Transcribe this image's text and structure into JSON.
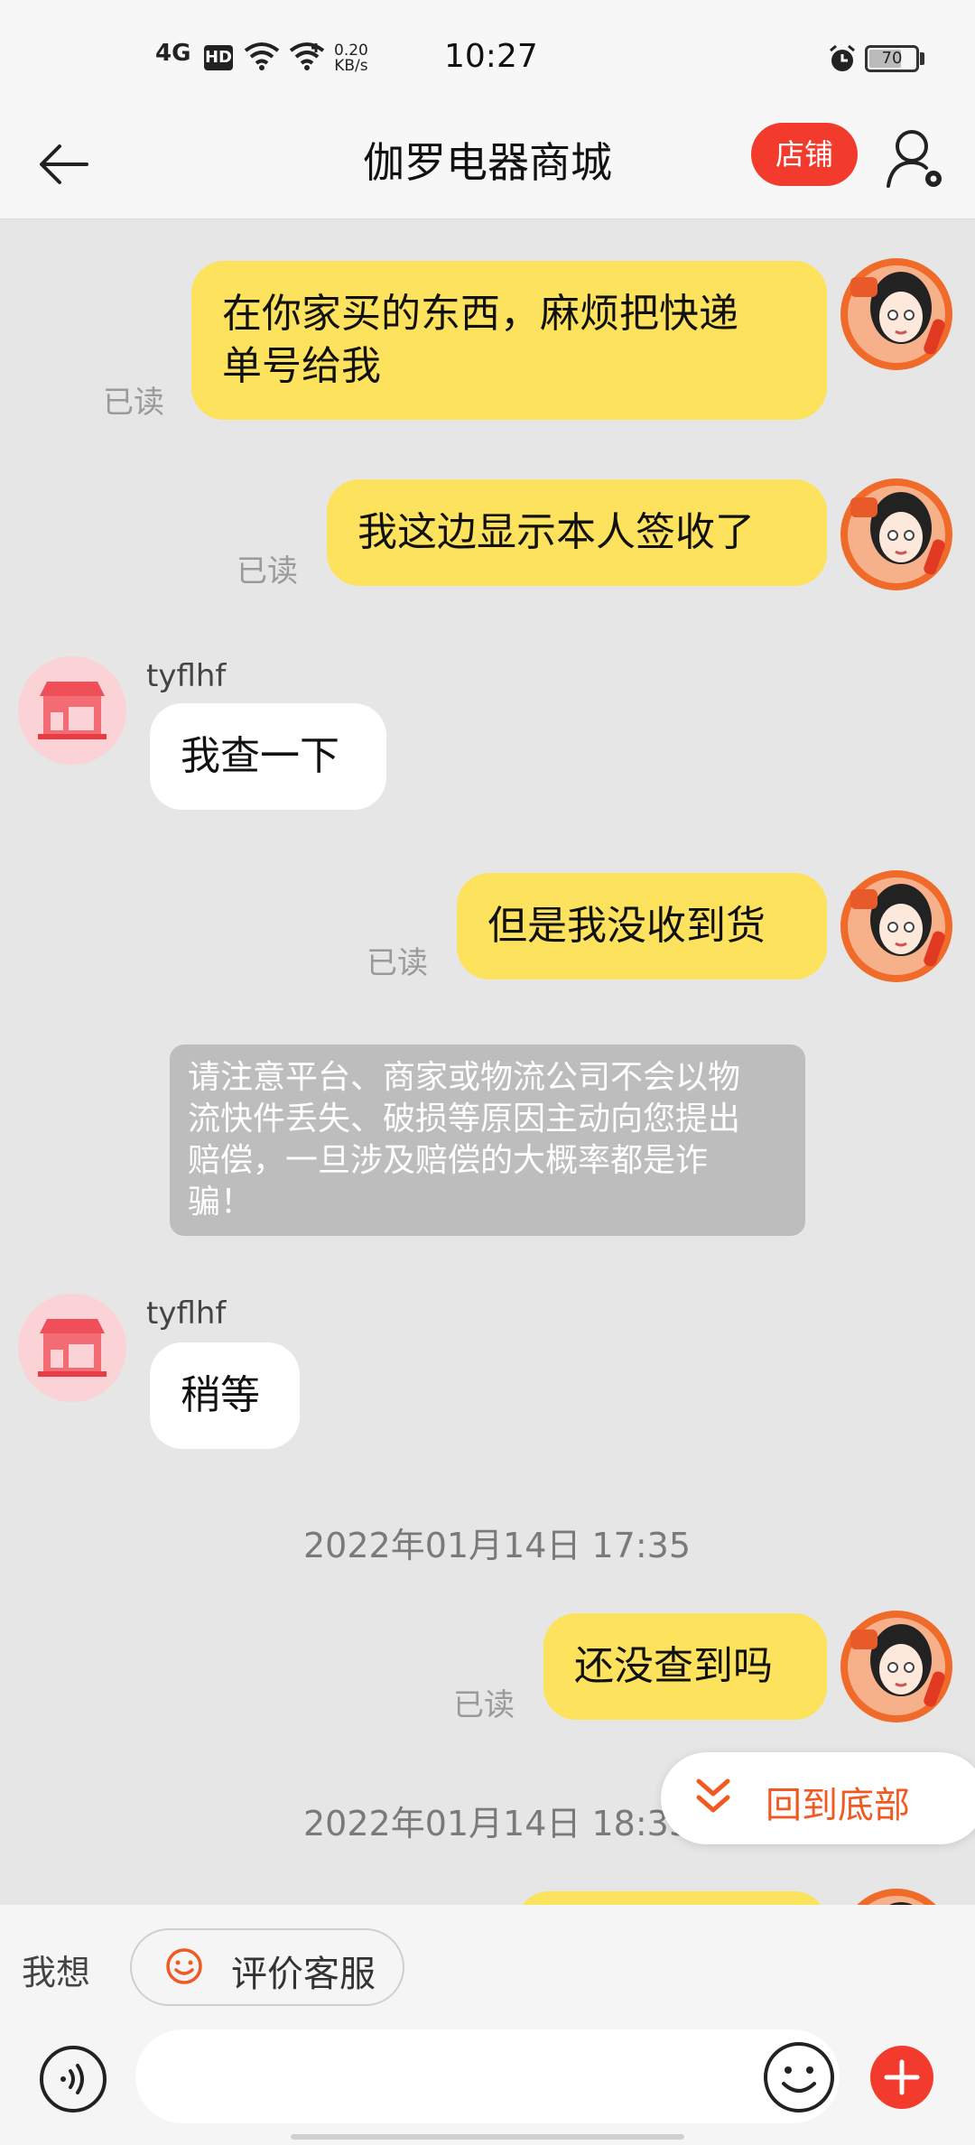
{
  "status_bar": {
    "network": "4G",
    "hd": "HD",
    "speed_value": "0.20",
    "speed_unit": "KB/s",
    "time": "10:27",
    "battery": "70",
    "battery_level": 0.7
  },
  "header": {
    "title": "伽罗电器商城",
    "shop_button": "店铺"
  },
  "messages": [
    {
      "side": "me",
      "lines": [
        "在你家买的东西，麻烦把快递",
        "单号给我"
      ],
      "read": "已读"
    },
    {
      "side": "me",
      "text": "我这边显示本人签收了",
      "read": "已读"
    },
    {
      "side": "them",
      "sender": "tyflhf",
      "text": "我查一下"
    },
    {
      "side": "me",
      "text": "但是我没收到货",
      "read": "已读"
    },
    {
      "side": "notice",
      "lines": [
        "请注意平台、商家或物流公司不会以物",
        "流快件丢失、破损等原因主动向您提出",
        "赔偿，一旦涉及赔偿的大概率都是诈",
        "骗！"
      ]
    },
    {
      "side": "them",
      "sender": "tyflhf",
      "text": "稍等"
    },
    {
      "side": "timestamp",
      "text": "2022年01月14日 17:35"
    },
    {
      "side": "me",
      "text": "还没查到吗",
      "read": "已读"
    },
    {
      "side": "timestamp",
      "text": "2022年01月14日 18:33"
    }
  ],
  "back_to_bottom": "回到底部",
  "footer": {
    "want_label": "我想",
    "rate_label": "评价客服",
    "input_placeholder": ""
  },
  "colors": {
    "accent": "#f23b2c",
    "my_bubble": "#fde25d",
    "chat_bg": "#e6e6e6",
    "link_orange": "#f05a22"
  }
}
